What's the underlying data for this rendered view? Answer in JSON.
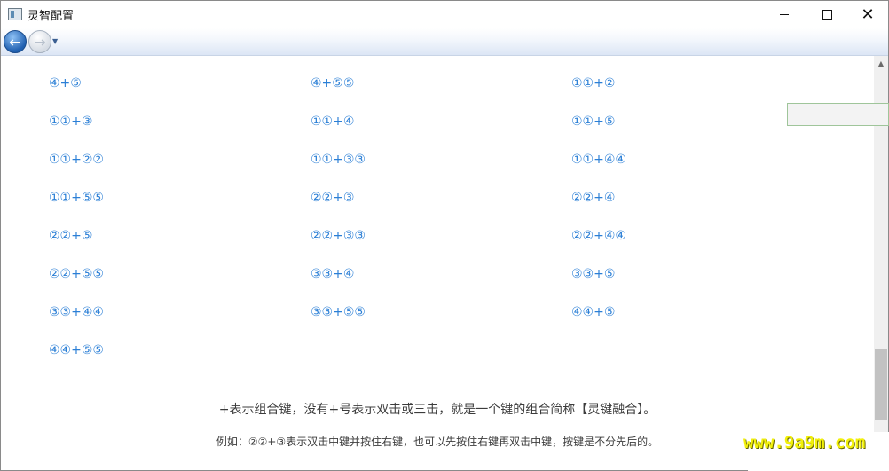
{
  "window": {
    "title": "灵智配置",
    "controls": {
      "minimize": "—",
      "maximize": "☐",
      "close": "✕"
    }
  },
  "nav": {
    "back": "←",
    "forward": "→",
    "dropdown": "▼"
  },
  "combos": [
    "④+⑤",
    "④+⑤⑤",
    "①①+②",
    "①①+③",
    "①①+④",
    "①①+⑤",
    "①①+②②",
    "①①+③③",
    "①①+④④",
    "①①+⑤⑤",
    "②②+③",
    "②②+④",
    "②②+⑤",
    "②②+③③",
    "②②+④④",
    "②②+⑤⑤",
    "③③+④",
    "③③+⑤",
    "③③+④④",
    "③③+⑤⑤",
    "④④+⑤",
    "④④+⑤⑤"
  ],
  "notes": {
    "line1": "+表示组合键，没有+号表示双击或三击，就是一个键的组合简称【灵键融合】。",
    "line2": "例如：②②+③表示双击中键并按住右键，也可以先按住右键再双击中键，按键是不分先后的。"
  },
  "scrollbar": {
    "up_arrow": "▲"
  },
  "watermark": "www.9a9m.com",
  "colors": {
    "link": "#2b7fd6",
    "text": "#3c3c3c",
    "watermark": "#f2f00a"
  }
}
